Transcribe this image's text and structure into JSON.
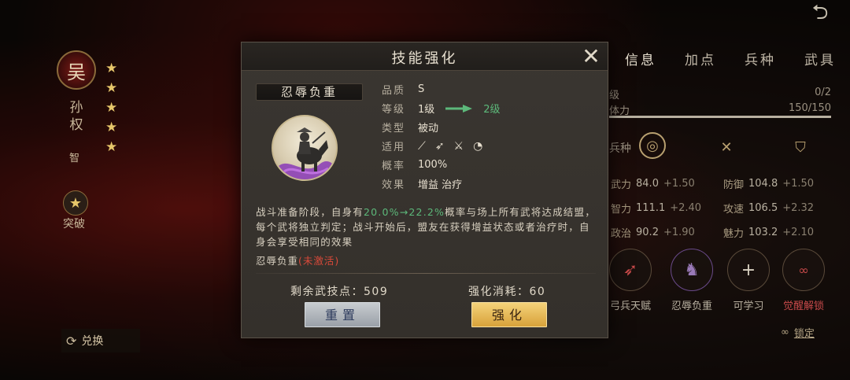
{
  "background": {
    "hero": {
      "faction_badge": "吴",
      "name": "孙权",
      "type": "智",
      "stars": 5,
      "breakthrough_label": "突破",
      "exchange_label": "兑换"
    },
    "right_panel": {
      "tabs": [
        "信息",
        "加点",
        "兵种",
        "武具"
      ],
      "active_tab": 0,
      "rank_label": "级",
      "rank_value": "0/2",
      "stamina_label": "体力",
      "stamina_value": "150/150",
      "troop_label": "兵种",
      "stats": [
        [
          {
            "name": "武力",
            "value": "84.0",
            "bonus": "+1.50"
          },
          {
            "name": "防御",
            "value": "104.8",
            "bonus": "+1.50"
          }
        ],
        [
          {
            "name": "智力",
            "value": "111.1",
            "bonus": "+2.40"
          },
          {
            "name": "攻速",
            "value": "106.5",
            "bonus": "+2.32"
          }
        ],
        [
          {
            "name": "政治",
            "value": "90.2",
            "bonus": "+1.90"
          },
          {
            "name": "魅力",
            "value": "103.2",
            "bonus": "+2.10"
          }
        ]
      ],
      "skill_slots": [
        {
          "label": "弓兵天赋"
        },
        {
          "label": "忍辱负重"
        },
        {
          "label": "可学习"
        },
        {
          "label": "觉醒解锁"
        }
      ],
      "lock_label": "锁定"
    }
  },
  "modal": {
    "title": "技能强化",
    "skill_name": "忍辱负重",
    "attributes": {
      "quality_label": "品质",
      "quality_value": "S",
      "level_label": "等级",
      "level_current": "1级",
      "level_next": "2级",
      "category_label": "类型",
      "category_value": "被动",
      "applicable_label": "适用",
      "rate_label": "概率",
      "rate_value": "100%",
      "effect_label": "效果",
      "effect_value": "增益 治疗"
    },
    "description": {
      "part1": "战斗准备阶段，自身有",
      "highlight": "20.0%→22.2%",
      "part2": "概率与场上所有武将达成结盟，每个武将独立判定；战斗开始后，盟友在获得增益状态或者治疗时，自身会享受相同的效果"
    },
    "status": {
      "name": "忍辱负重",
      "state": "(未激活)"
    },
    "remaining_points_label": "剩余武技点：509",
    "cost_label": "强化消耗：60",
    "reset_button": "重置",
    "strengthen_button": "强化",
    "colors": {
      "highlight_green": "#5cb87a",
      "inactive_red": "#d94a3a",
      "gold_button": "#e8b84a"
    }
  }
}
